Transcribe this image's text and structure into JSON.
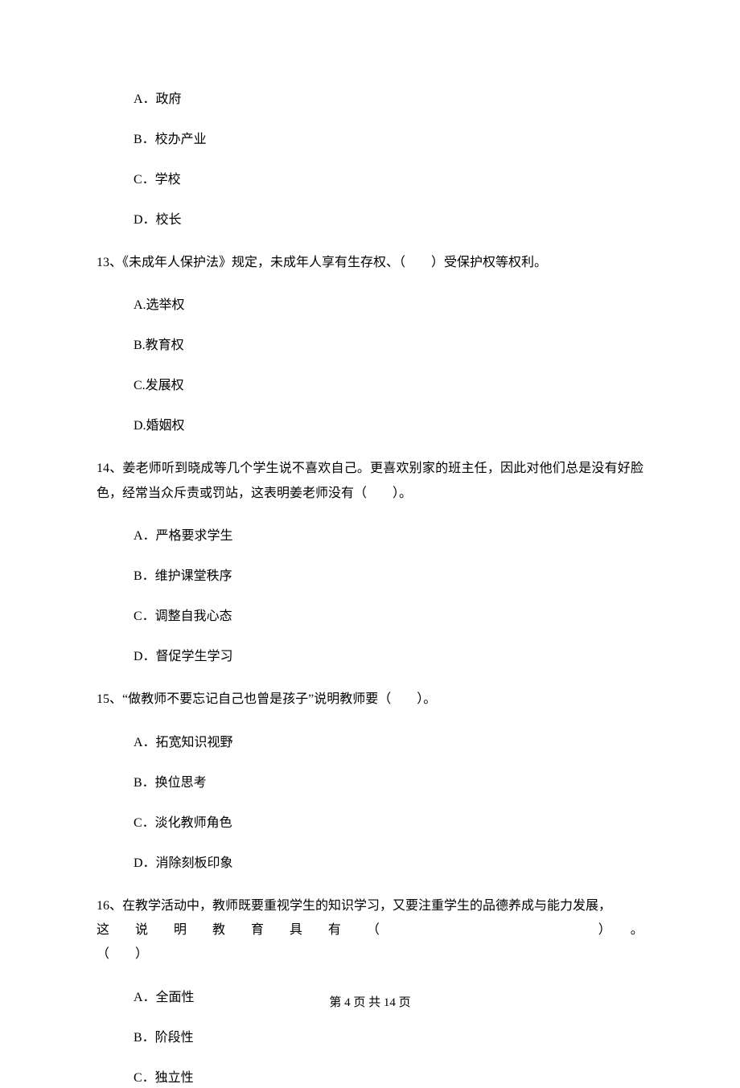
{
  "q12": {
    "options": {
      "a": "A．政府",
      "b": "B．校办产业",
      "c": "C．学校",
      "d": "D．校长"
    }
  },
  "q13": {
    "stem": "13、《未成年人保护法》规定，未成年人享有生存权、（　　）受保护权等权利。",
    "options": {
      "a": "A.选举权",
      "b": "B.教育权",
      "c": "C.发展权",
      "d": "D.婚姻权"
    }
  },
  "q14": {
    "stem": "14、姜老师听到晓成等几个学生说不喜欢自己。更喜欢别家的班主任，因此对他们总是没有好脸色，经常当众斥责或罚站，这表明姜老师没有（　　）。",
    "options": {
      "a": "A．严格要求学生",
      "b": "B．维护课堂秩序",
      "c": "C．调整自我心态",
      "d": "D．督促学生学习"
    }
  },
  "q15": {
    "stem": "15、“做教师不要忘记自己也曾是孩子”说明教师要（　　）。",
    "options": {
      "a": "A．拓宽知识视野",
      "b": "B．换位思考",
      "c": "C．淡化教师角色",
      "d": "D．消除刻板印象"
    }
  },
  "q16": {
    "line1": "16、在教学活动中，教师既要重视学生的知识学习，又要注重学生的品德养成与能力发展，",
    "line2": "这说明教育具有（　　　　　）。",
    "line3": "（　　）",
    "options": {
      "a": "A．全面性",
      "b": "B．阶段性",
      "c": "C．独立性"
    }
  },
  "footer": "第 4 页 共 14 页"
}
